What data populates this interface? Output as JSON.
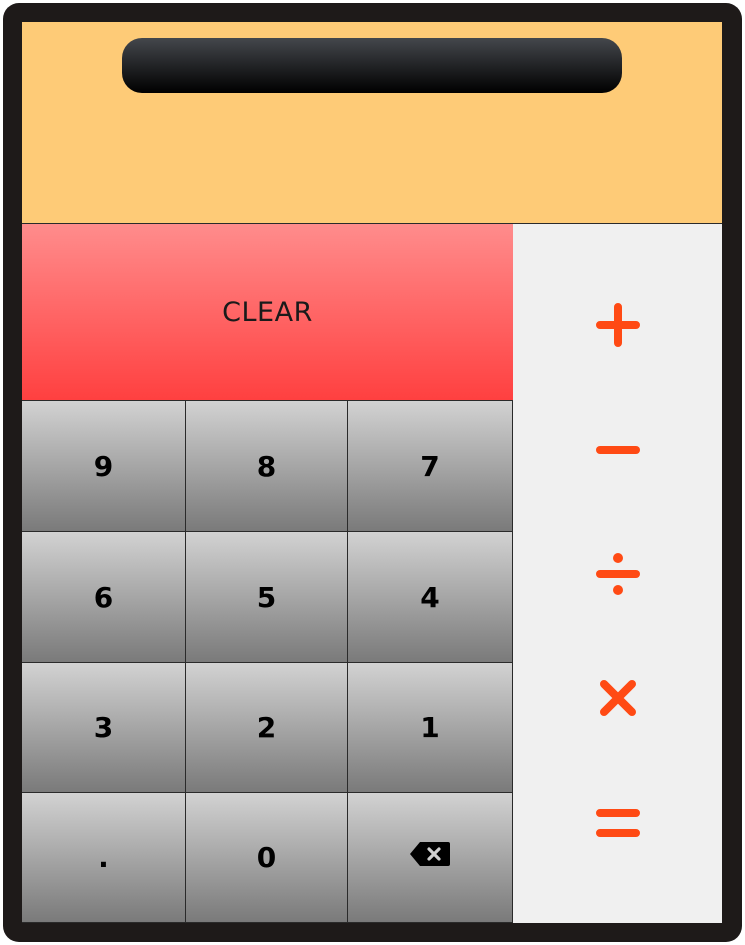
{
  "display": {
    "value": ""
  },
  "buttons": {
    "clear": "CLEAR",
    "digits": [
      "9",
      "8",
      "7",
      "6",
      "5",
      "4",
      "3",
      "2",
      "1",
      ".",
      "0"
    ]
  },
  "icons": {
    "backspace": "backspace-icon",
    "plus": "plus-icon",
    "minus": "minus-icon",
    "divide": "divide-icon",
    "multiply": "multiply-icon",
    "equals": "equals-icon"
  },
  "colors": {
    "frame": "#1e1a19",
    "screen": "#fecb77",
    "operator": "#ff4a14",
    "clear_top": "#ff8c8c",
    "clear_bottom": "#ff4040",
    "ops_panel": "#f0f0f0"
  }
}
